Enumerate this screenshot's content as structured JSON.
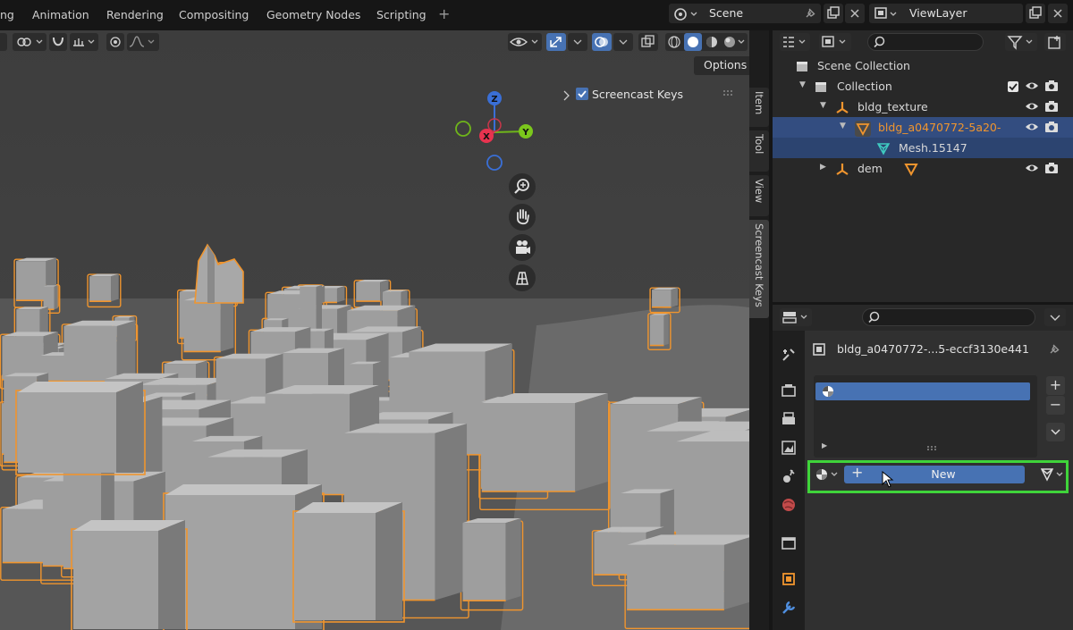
{
  "workspace_tabs": [
    "ng",
    "Animation",
    "Rendering",
    "Compositing",
    "Geometry Nodes",
    "Scripting"
  ],
  "scene": {
    "name": "Scene"
  },
  "view_layer": {
    "name": "ViewLayer"
  },
  "viewport": {
    "options_label": "Options",
    "overlay_checkbox_label": "Screencast Keys",
    "gizmo_axes": {
      "x": "X",
      "y": "Y",
      "z": "Z"
    },
    "sidebar_tabs": [
      "Item",
      "Tool",
      "View",
      "Screencast Keys"
    ]
  },
  "outliner": {
    "rows": [
      {
        "label": "Scene Collection"
      },
      {
        "label": "Collection"
      },
      {
        "label": "bldg_texture"
      },
      {
        "label": "bldg_a0470772-5a20-"
      },
      {
        "label": "Mesh.15147"
      },
      {
        "label": "dem"
      }
    ]
  },
  "properties": {
    "object_name": "bldg_a0470772-...5-eccf3130e441",
    "new_button_label": "New",
    "add_slot": "+",
    "remove_slot": "−"
  },
  "colors": {
    "accent": "#4772b3",
    "selection_outline": "#f0952e",
    "highlight_box": "#3fd43a"
  }
}
